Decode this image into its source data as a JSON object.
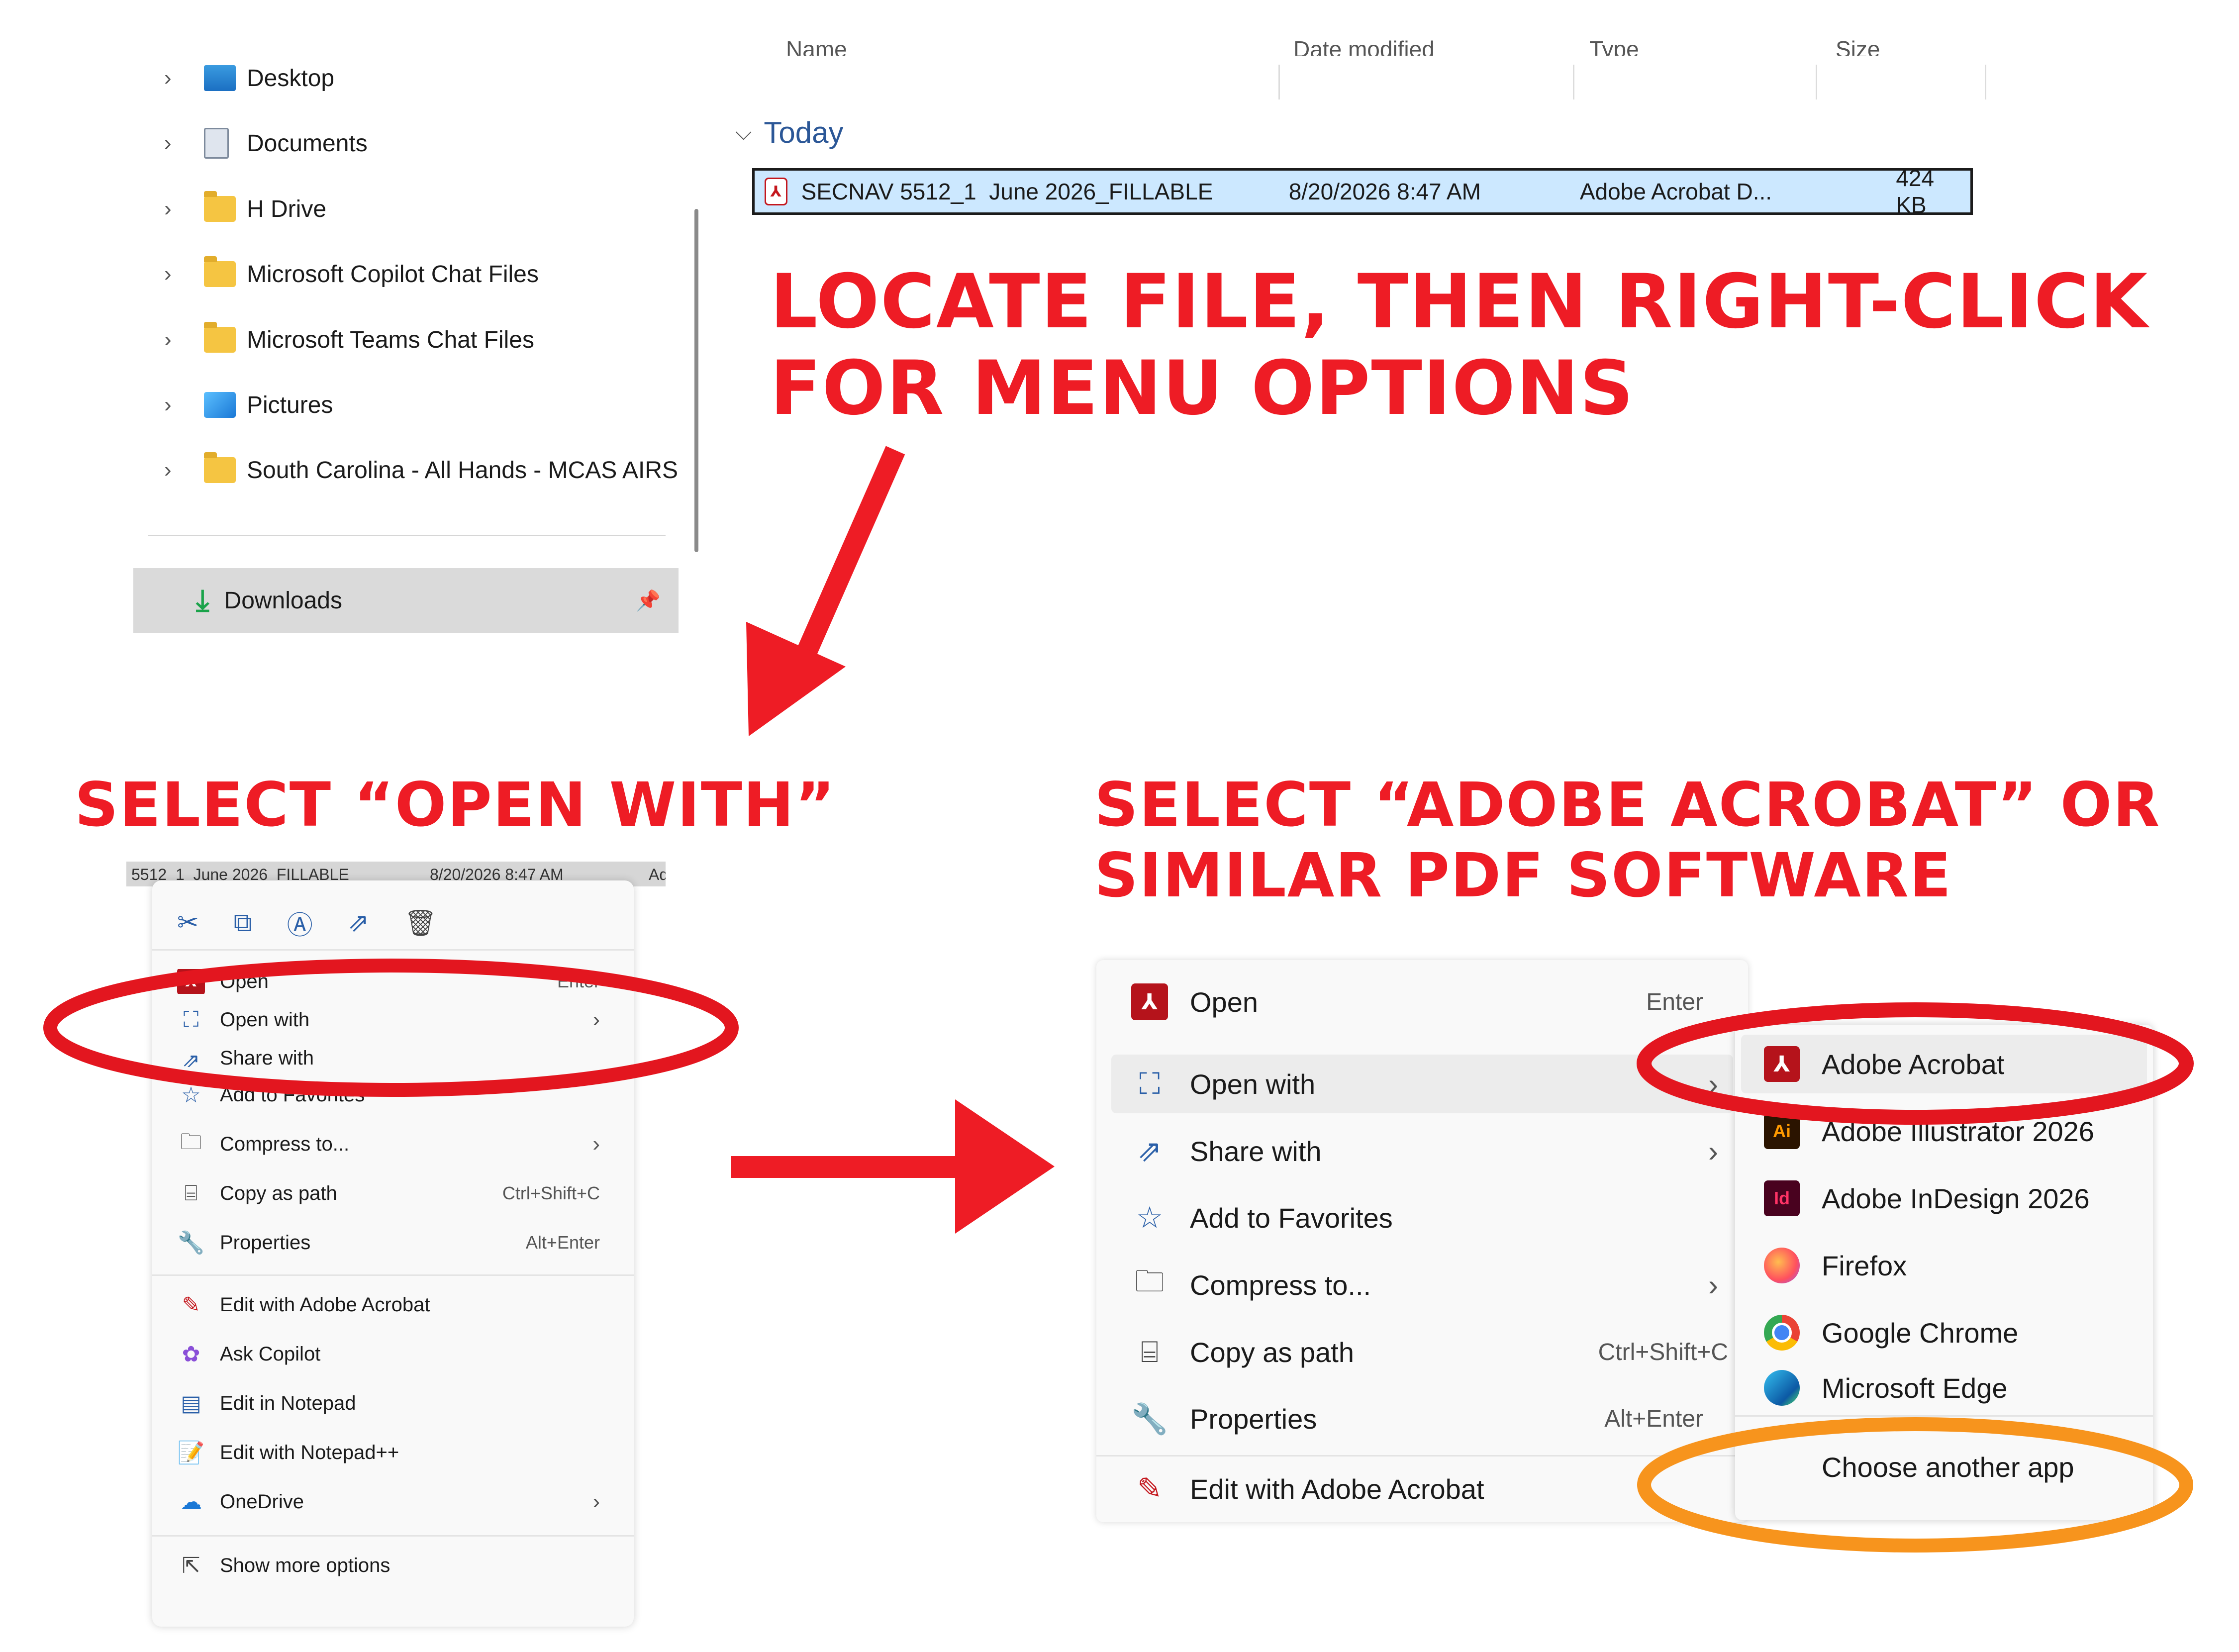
{
  "explorer": {
    "nav_items": [
      {
        "label": "Desktop",
        "icon": "desktop-icon"
      },
      {
        "label": "Documents",
        "icon": "documents-icon"
      },
      {
        "label": "H Drive",
        "icon": "folder-icon"
      },
      {
        "label": "Microsoft Copilot Chat Files",
        "icon": "folder-icon"
      },
      {
        "label": "Microsoft Teams Chat Files",
        "icon": "folder-icon"
      },
      {
        "label": "Pictures",
        "icon": "pictures-icon"
      },
      {
        "label": "South Carolina - All Hands - MCAS AIRS",
        "icon": "shared-folder-icon"
      }
    ],
    "downloads_label": "Downloads",
    "columns": {
      "name": "Name",
      "date": "Date modified",
      "type": "Type",
      "size": "Size"
    },
    "group_label": "Today",
    "file": {
      "name": "SECNAV 5512_1  June 2026_FILLABLE",
      "date": "8/20/2026 8:47 AM",
      "type": "Adobe Acrobat D...",
      "size": "424 KB"
    }
  },
  "instructions": {
    "step1_line1": "LOCATE FILE, THEN RIGHT-CLICK",
    "step1_line2": "FOR MENU OPTIONS",
    "step2": "SELECT “OPEN WITH”",
    "step3_line1": "SELECT “ADOBE ACROBAT” OR",
    "step3_line2": "SIMILAR PDF SOFTWARE"
  },
  "small_menu": {
    "peek_name": "5512_1  June 2026_FILLABLE",
    "peek_date": "8/20/2026 8:47 AM",
    "peek_type": "Ad",
    "toolbar_icons": [
      "cut-icon",
      "copy-icon",
      "rename-icon",
      "share-icon",
      "delete-icon"
    ],
    "items": [
      {
        "label": "Open",
        "shortcut": "Enter"
      },
      {
        "label": "Open with"
      },
      {
        "label": "Share with"
      },
      {
        "label": "Add to Favorites"
      },
      {
        "label": "Compress to..."
      },
      {
        "label": "Copy as path",
        "shortcut": "Ctrl+Shift+C"
      },
      {
        "label": "Properties",
        "shortcut": "Alt+Enter"
      },
      {
        "label": "Edit with Adobe Acrobat"
      },
      {
        "label": "Ask Copilot"
      },
      {
        "label": "Edit in Notepad"
      },
      {
        "label": "Edit with Notepad++"
      },
      {
        "label": "OneDrive"
      },
      {
        "label": "Show more options"
      }
    ]
  },
  "large_menu": {
    "items": [
      {
        "label": "Open",
        "shortcut": "Enter"
      },
      {
        "label": "Open with"
      },
      {
        "label": "Share with"
      },
      {
        "label": "Add to Favorites"
      },
      {
        "label": "Compress to..."
      },
      {
        "label": "Copy as path",
        "shortcut": "Ctrl+Shift+C"
      },
      {
        "label": "Properties",
        "shortcut": "Alt+Enter"
      },
      {
        "label": "Edit with Adobe Acrobat"
      }
    ]
  },
  "open_with_submenu": {
    "items": [
      {
        "label": "Adobe Acrobat",
        "icon": "acrobat-icon"
      },
      {
        "label": "Adobe Illustrator 2026",
        "icon": "illustrator-icon",
        "badge": "Ai"
      },
      {
        "label": "Adobe InDesign 2026",
        "icon": "indesign-icon",
        "badge": "Id"
      },
      {
        "label": "Firefox",
        "icon": "firefox-icon"
      },
      {
        "label": "Google Chrome",
        "icon": "chrome-icon"
      },
      {
        "label": "Microsoft Edge",
        "icon": "edge-icon"
      },
      {
        "label": "Choose another app"
      }
    ]
  },
  "colors": {
    "annotation_red": "#ee1c25",
    "annotation_orange": "#f7941d",
    "selection_blue": "#cce8ff"
  }
}
